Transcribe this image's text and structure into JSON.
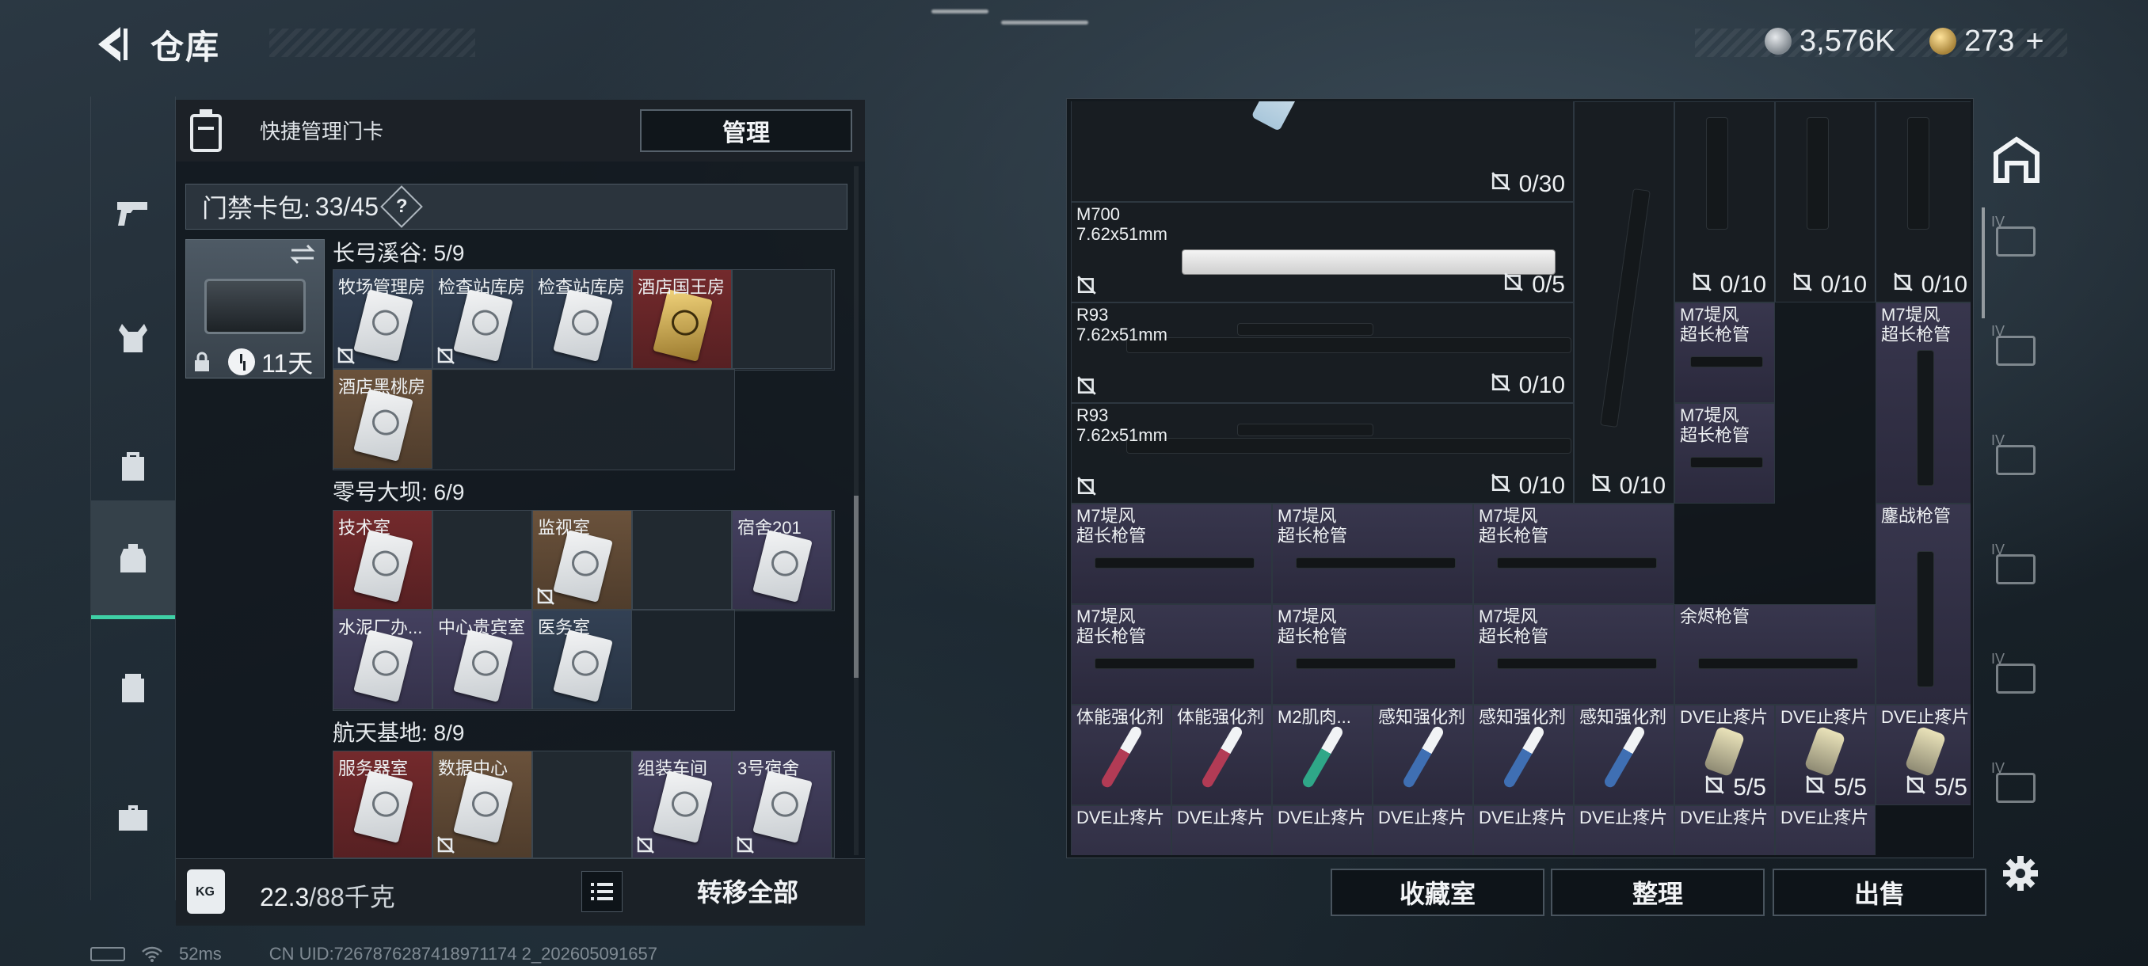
{
  "header": {
    "title": "仓库"
  },
  "currency": [
    {
      "value": "3,576K",
      "color": "#c9ced3"
    },
    {
      "value": "273",
      "suffix": "+",
      "color": "#d8b45b"
    }
  ],
  "left_nav": [
    "weapon",
    "armor",
    "backpack",
    "keycard-case",
    "container",
    "toolbox"
  ],
  "key_panel": {
    "title": "快捷管理门卡",
    "manage_label": "管理",
    "bag_label": "门禁卡包:",
    "bag_count": "33/45",
    "help": "?",
    "days": "11天",
    "sections": [
      {
        "title": "长弓溪谷: 5/9",
        "rooms": [
          {
            "name": "牧场管理房",
            "color": "blue",
            "no_bind": true
          },
          {
            "name": "检查站库房",
            "color": "blue",
            "no_bind": true
          },
          {
            "name": "检查站库房",
            "color": "blue",
            "no_bind": false
          },
          {
            "name": "酒店国王房",
            "color": "red",
            "gold": true,
            "no_bind": false
          },
          {
            "name": "",
            "color": "empty"
          },
          {
            "name": "酒店黑桃房",
            "color": "brown",
            "no_bind": false
          }
        ]
      },
      {
        "title": "零号大坝: 6/9",
        "rooms": [
          {
            "name": "技术室",
            "color": "red"
          },
          {
            "name": "",
            "color": "empty"
          },
          {
            "name": "监视室",
            "color": "brown",
            "no_bind": true
          },
          {
            "name": "",
            "color": "empty"
          },
          {
            "name": "宿舍201",
            "color": "purple"
          },
          {
            "name": "水泥厂办...",
            "color": "purple"
          },
          {
            "name": "中心贵宾室",
            "color": "purple"
          },
          {
            "name": "医务室",
            "color": "blue"
          }
        ]
      },
      {
        "title": "航天基地: 8/9",
        "rooms": [
          {
            "name": "服务器室",
            "color": "red"
          },
          {
            "name": "数据中心",
            "color": "brown",
            "no_bind": true
          },
          {
            "name": "",
            "color": "empty"
          },
          {
            "name": "组装车间",
            "color": "purple",
            "no_bind": true
          },
          {
            "name": "3号宿舍",
            "color": "purple",
            "no_bind": true
          }
        ]
      }
    ],
    "weight_current": "22.3",
    "weight_total": "/88千克",
    "weight_icon_label": "KG",
    "transfer_label": "转移全部"
  },
  "inventory": {
    "items": [
      {
        "name": "",
        "count": "0/30"
      },
      {
        "name": "M700\n7.62x51mm",
        "count": "0/5"
      },
      {
        "name": "R93\n7.62x51mm",
        "count": "0/10"
      },
      {
        "name": "R93\n7.62x51mm",
        "count": "0/10"
      },
      {
        "name": "",
        "count": "0/10"
      },
      {
        "name": "",
        "count": "0/10"
      },
      {
        "name": "",
        "count": "0/10"
      },
      {
        "name": "",
        "count": "0/10"
      },
      {
        "name": "M7堤风\n超长枪管",
        "count": ""
      },
      {
        "name": "M7堤风\n超长枪管",
        "count": ""
      },
      {
        "name": "M7堤风\n超长枪管",
        "count": ""
      },
      {
        "name": "M7堤风\n超长枪管",
        "count": ""
      },
      {
        "name": "M7堤风\n超长枪管",
        "count": ""
      },
      {
        "name": "M7堤风\n超长枪管",
        "count": ""
      },
      {
        "name": "鏖战枪管",
        "count": ""
      },
      {
        "name": "M7堤风\n超长枪管",
        "count": ""
      },
      {
        "name": "M7堤风\n超长枪管",
        "count": ""
      },
      {
        "name": "M7堤风\n超长枪管",
        "count": ""
      },
      {
        "name": "余烬枪管",
        "count": ""
      },
      {
        "name": "体能强化剂",
        "count": ""
      },
      {
        "name": "体能强化剂",
        "count": ""
      },
      {
        "name": "M2肌肉...",
        "count": ""
      },
      {
        "name": "感知强化剂",
        "count": ""
      },
      {
        "name": "感知强化剂",
        "count": ""
      },
      {
        "name": "DVE止疼片",
        "count": "5/5"
      },
      {
        "name": "DVE止疼片",
        "count": "5/5"
      },
      {
        "name": "DVE止疼片",
        "count": "5/5"
      },
      {
        "name": "DVE止疼片",
        "count": ""
      },
      {
        "name": "DVE止疼片",
        "count": ""
      },
      {
        "name": "DVE止疼片",
        "count": ""
      },
      {
        "name": "DVE止疼片",
        "count": ""
      },
      {
        "name": "DVE止疼片",
        "count": ""
      },
      {
        "name": "DVE止疼片",
        "count": ""
      },
      {
        "name": "DVE止疼片",
        "count": ""
      },
      {
        "name": "DVE止疼片",
        "count": ""
      }
    ]
  },
  "side_tabs": [
    {
      "icon": "storage-tab-icon",
      "level": ""
    },
    {
      "icon": "container-add-icon",
      "level": "IV"
    },
    {
      "icon": "container-icon-2",
      "level": "IV"
    },
    {
      "icon": "container-icon-3",
      "level": "IV"
    },
    {
      "icon": "container-icon-4",
      "level": "IV"
    },
    {
      "icon": "container-icon-5",
      "level": "IV"
    },
    {
      "icon": "container-icon-6",
      "level": "IV"
    }
  ],
  "bottom_buttons": {
    "collection": "收藏室",
    "sort": "整理",
    "sell": "出售"
  },
  "status": {
    "ping": "52ms",
    "uid": "CN UID:7267876287418971174 2_202605091657"
  }
}
